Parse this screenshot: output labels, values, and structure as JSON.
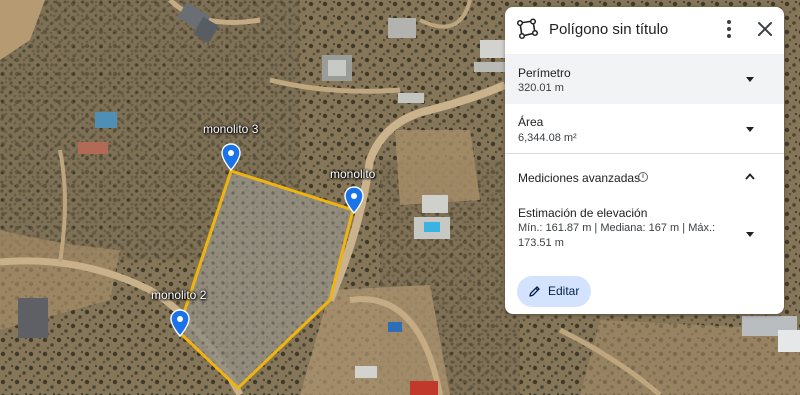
{
  "map": {
    "markers": [
      {
        "id": "monolito-3",
        "label": "monolito 3"
      },
      {
        "id": "monolito",
        "label": "monolito"
      },
      {
        "id": "monolito-2",
        "label": "monolito 2"
      }
    ],
    "polygon_color": "#f4b400",
    "pin_color": "#1a73e8"
  },
  "panel": {
    "title": "Polígono sin título",
    "icons": {
      "polygon": "polygon-icon",
      "more": "more-vert-icon",
      "close": "close-icon",
      "info": "info-icon",
      "edit": "pencil-icon"
    },
    "perimeter": {
      "label": "Perímetro",
      "value": "320.01 m"
    },
    "area": {
      "label": "Área",
      "value": "6,344.08 m²"
    },
    "advanced": {
      "label": "Mediciones avanzadas"
    },
    "elevation": {
      "label": "Estimación de elevación",
      "stats": "Mín.: 161.87 m | Mediana: 167 m | Máx.: 173.51 m"
    },
    "edit_label": "Editar",
    "edit_button_color": "#d3e3fd"
  }
}
